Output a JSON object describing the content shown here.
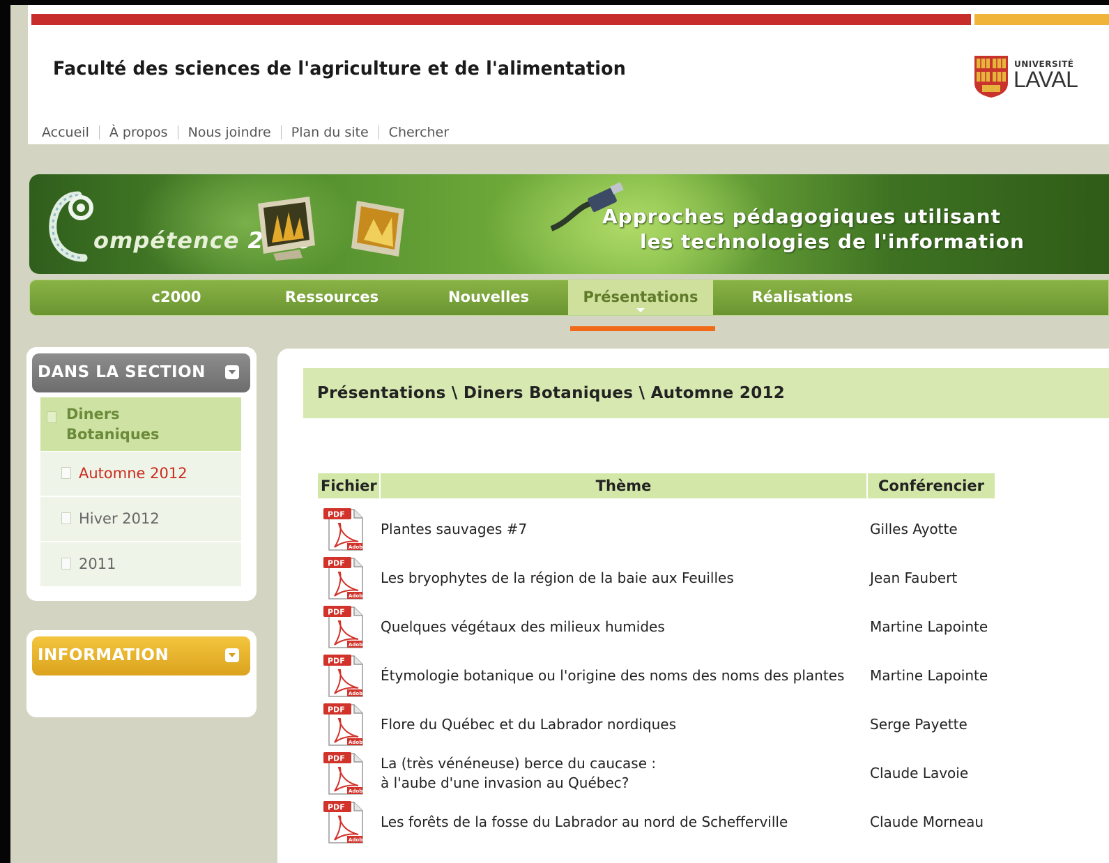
{
  "header": {
    "faculty_title": "Faculté des sciences de l'agriculture et de l'alimentation",
    "logo_small": "UNIVERSITÉ",
    "logo_big": "LAVAL"
  },
  "topnav": [
    "Accueil",
    "À propos",
    "Nous joindre",
    "Plan du site",
    "Chercher"
  ],
  "banner": {
    "brand_prefix": "ompétence",
    "brand_year": "2000",
    "tagline_line1": "Approches pédagogiques utilisant",
    "tagline_line2": "les technologies de l'information"
  },
  "mainnav": [
    {
      "label": "c2000",
      "active": false
    },
    {
      "label": "Ressources",
      "active": false
    },
    {
      "label": "Nouvelles",
      "active": false
    },
    {
      "label": "Présentations",
      "active": true
    },
    {
      "label": "Réalisations",
      "active": false
    }
  ],
  "sidebar": {
    "section_title": "DANS LA SECTION",
    "parent_item": "Diners Botaniques",
    "items": [
      {
        "label": "Automne 2012",
        "current": true
      },
      {
        "label": "Hiver 2012",
        "current": false
      },
      {
        "label": "2011",
        "current": false
      }
    ],
    "info_title": "INFORMATION"
  },
  "breadcrumb": "Présentations \\ Diners Botaniques \\ Automne 2012",
  "table": {
    "headers": {
      "file": "Fichier",
      "theme": "Thème",
      "speaker": "Conférencier"
    },
    "rows": [
      {
        "theme": "Plantes sauvages #7",
        "speaker": "Gilles Ayotte"
      },
      {
        "theme": "Les bryophytes de la région de la baie aux Feuilles",
        "speaker": "Jean Faubert"
      },
      {
        "theme": "Quelques végétaux des milieux humides",
        "speaker": "Martine Lapointe"
      },
      {
        "theme": "Étymologie botanique ou l'origine des noms des noms des plantes",
        "speaker": "Martine Lapointe"
      },
      {
        "theme": "Flore du Québec et du Labrador nordiques",
        "speaker": "Serge Payette"
      },
      {
        "theme": "La (très vénéneuse) berce du caucase :",
        "theme_line2": "à l'aube d'une invasion au Québec?",
        "speaker": "Claude Lavoie"
      },
      {
        "theme": "Les forêts de la fosse du Labrador au nord de Schefferville",
        "speaker": "Claude Morneau"
      }
    ]
  },
  "pdf_icon": {
    "tag": "PDF",
    "brand": "Adobe"
  },
  "colors": {
    "accent_red": "#c62d2b",
    "accent_gold": "#f0b43a",
    "nav_green": "#7aa43a",
    "annotation_orange": "#f06a1a",
    "current_item_red": "#cc2a1e"
  }
}
